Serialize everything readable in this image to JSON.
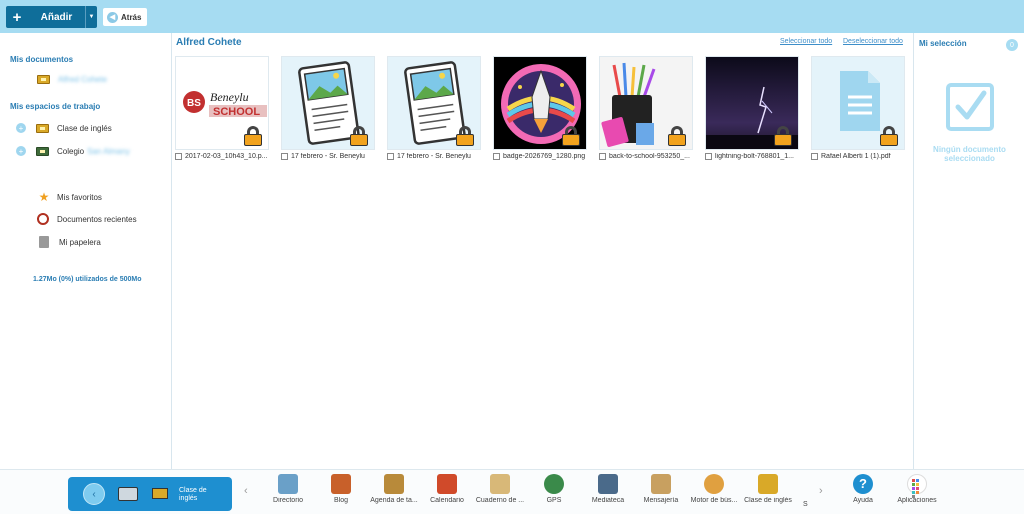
{
  "toolbar": {
    "add_label": "Añadir",
    "back_label": "Atrás"
  },
  "sidebar": {
    "my_docs_heading": "Mis documentos",
    "user_folder": "Alfred Cohete",
    "workspaces_heading": "Mis espacios de trabajo",
    "workspaces": [
      {
        "label": "Clase de inglés"
      },
      {
        "label": "Colegio",
        "blurred": "San Almany"
      }
    ],
    "favorites": "Mis favoritos",
    "recent": "Documentos recientes",
    "trash": "Mi papelera",
    "quota": "1.27Mo (0%) utilizados de 500Mo"
  },
  "main": {
    "title": "Alfred Cohete",
    "select_all": "Seleccionar todo",
    "deselect_all": "Deseleccionar todo",
    "files": [
      {
        "name": "2017-02-03_10h43_10.p...",
        "thumb": "beneylu-logo",
        "logo_text_1": "Beneylu",
        "logo_text_2": "SCHOOL",
        "logo_badge": "BS"
      },
      {
        "name": "17 febrero - Sr. Beneylu",
        "thumb": "document-image-icon"
      },
      {
        "name": "17 febrero - Sr. Beneylu",
        "thumb": "document-image-icon"
      },
      {
        "name": "badge-2026769_1280.png",
        "thumb": "space-shuttle-badge"
      },
      {
        "name": "back-to-school-953250_...",
        "thumb": "pencil-cup-photo"
      },
      {
        "name": "lightning-bolt-768801_1...",
        "thumb": "lightning-photo"
      },
      {
        "name": "Rafael Alberti 1 (1).pdf",
        "thumb": "pdf-document-icon"
      }
    ]
  },
  "selection": {
    "title": "Mi selección",
    "count": "0",
    "empty_message": "Ningún documento seleccionado"
  },
  "dock": {
    "current": "Clase de inglés",
    "apps": [
      {
        "label": "Directorio",
        "icon": "directory-icon",
        "color": "#6aa0c8"
      },
      {
        "label": "Blog",
        "icon": "blog-icon",
        "color": "#c8602a"
      },
      {
        "label": "Agenda de ta...",
        "icon": "agenda-icon",
        "color": "#b88a3a"
      },
      {
        "label": "Calendario",
        "icon": "calendar-icon",
        "color": "#d04a2a"
      },
      {
        "label": "Cuaderno de ...",
        "icon": "notebook-icon",
        "color": "#d8b878"
      },
      {
        "label": "GPS",
        "icon": "globe-icon",
        "color": "#3a8a4a"
      },
      {
        "label": "Mediateca",
        "icon": "media-library-icon",
        "color": "#4a6a8a"
      },
      {
        "label": "Mensajería",
        "icon": "mail-icon",
        "color": "#c8a060"
      },
      {
        "label": "Motor de bús...",
        "icon": "search-icon",
        "color": "#e0a040"
      },
      {
        "label": "Clase de inglés",
        "icon": "class-icon",
        "color": "#d9a928"
      },
      {
        "label": "Ayuda",
        "icon": "help-icon",
        "color": "#1e8fd0"
      },
      {
        "label": "Aplicaciones",
        "icon": "apps-grid-icon",
        "color": "#e04a7a"
      }
    ],
    "partial_label": "S"
  }
}
